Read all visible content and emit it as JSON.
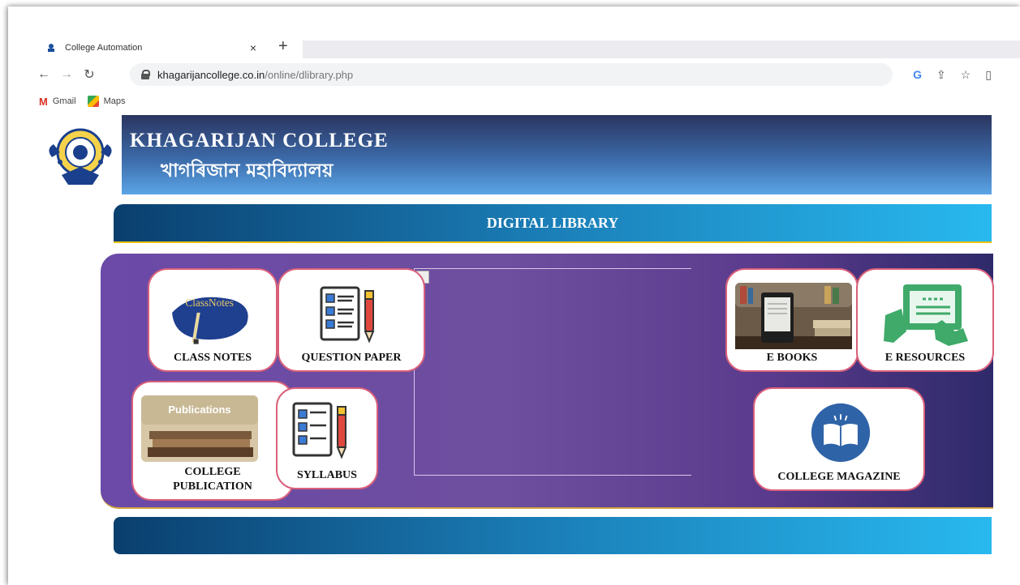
{
  "browser": {
    "tab_title": "College Automation",
    "tab_close": "×",
    "new_tab": "+",
    "url_host": "khagarijancollege.co.in",
    "url_path": "/online/dlibrary.php",
    "bookmarks": [
      {
        "label": "Gmail",
        "icon": "gmail-icon"
      },
      {
        "label": "Maps",
        "icon": "maps-icon"
      }
    ]
  },
  "site": {
    "college_name_en": "KHAGARIJAN COLLEGE",
    "college_name_as": "খাগৰিজান মহাবিদ্যালয়",
    "banner_title": "DIGITAL LIBRARY"
  },
  "cards": {
    "class_notes": {
      "label": "CLASS NOTES",
      "img_text": "ClassNotes"
    },
    "question_paper": {
      "label": "QUESTION PAPER"
    },
    "ebooks": {
      "label": "E BOOKS"
    },
    "eresources": {
      "label": "E RESOURCES"
    },
    "college_publication": {
      "label_line1": "COLLEGE",
      "label_line2": "PUBLICATION",
      "img_text": "Publications"
    },
    "syllabus": {
      "label": "SYLLABUS"
    },
    "college_magazine": {
      "label": "COLLEGE MAGAZINE"
    }
  },
  "colors": {
    "header_dark": "#2a3560",
    "banner_light": "#28b9ef",
    "panel_purple": "#6b4aa8",
    "card_border": "#d9607a"
  }
}
